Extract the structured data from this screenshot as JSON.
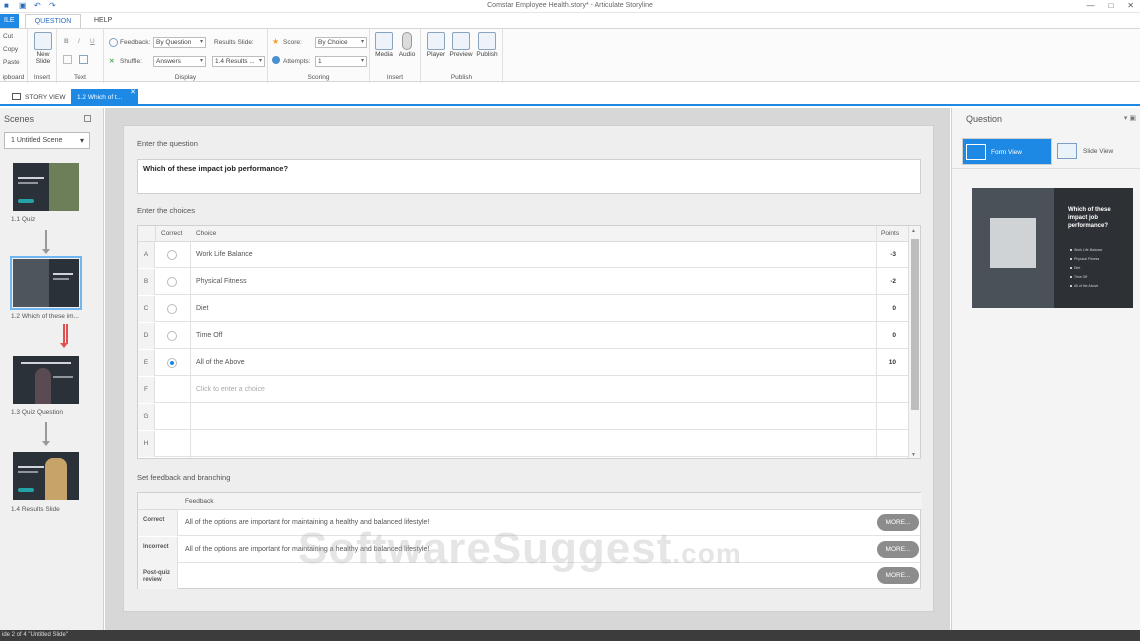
{
  "window": {
    "title": "Comstar Employee Health.story* - Articulate Storyline"
  },
  "ribbon_tabs": {
    "file": "ILE",
    "question": "QUESTION",
    "help": "HELP"
  },
  "ribbon": {
    "clipboard": {
      "cut": "Cut",
      "copy": "Copy",
      "paste": "Paste",
      "label": "ipboard"
    },
    "insert_group": {
      "new_slide": "New Slide",
      "label": "Insert"
    },
    "text_group": {
      "bold": "B",
      "italic": "I",
      "underline": "U",
      "label": "Text"
    },
    "display": {
      "feedback_label": "Feedback:",
      "feedback_value": "By Question",
      "results_label": "Results Slide:",
      "shuffle_label": "Shuffle:",
      "shuffle_value": "Answers",
      "results_value": "1.4 Results ...",
      "label": "Display"
    },
    "scoring": {
      "score_label": "Score:",
      "score_value": "By Choice",
      "attempts_label": "Attempts:",
      "attempts_value": "1",
      "label": "Scoring"
    },
    "insert_media": {
      "media": "Media",
      "audio": "Audio",
      "label": "Insert"
    },
    "publish": {
      "player": "Player",
      "preview": "Preview",
      "publish": "Publish",
      "label": "Publish"
    }
  },
  "doc_tabs": {
    "story_view": "STORY VIEW",
    "slide_tab": "1.2 Which of t..."
  },
  "scenes": {
    "header": "Scenes",
    "selected_scene": "1 Untitled Scene",
    "slides": [
      {
        "caption": "1.1 Quiz"
      },
      {
        "caption": "1.2 Which of these im..."
      },
      {
        "caption": "1.3 Quiz Question"
      },
      {
        "caption": "1.4 Results Slide"
      }
    ]
  },
  "form": {
    "question_label": "Enter the question",
    "question_text": "Which of these impact job performance?",
    "choices_label": "Enter the choices",
    "headers": {
      "correct": "Correct",
      "choice": "Choice",
      "points": "Points"
    },
    "choices": [
      {
        "letter": "A",
        "text": "Work Life Balance",
        "points": "-3",
        "correct": false
      },
      {
        "letter": "B",
        "text": "Physical Fitness",
        "points": "-2",
        "correct": false
      },
      {
        "letter": "C",
        "text": "Diet",
        "points": "0",
        "correct": false
      },
      {
        "letter": "D",
        "text": "Time Off",
        "points": "0",
        "correct": false
      },
      {
        "letter": "E",
        "text": "All of the Above",
        "points": "10",
        "correct": true
      },
      {
        "letter": "F",
        "text": "",
        "placeholder": "Click to enter a choice",
        "points": ""
      },
      {
        "letter": "G",
        "text": "",
        "points": ""
      },
      {
        "letter": "H",
        "text": "",
        "points": ""
      }
    ],
    "feedback_label": "Set feedback and branching",
    "feedback_header": "Feedback",
    "feedback": [
      {
        "label": "Correct",
        "text": "All of the options are important for maintaining a healthy and balanced lifestyle!",
        "button": "MORE..."
      },
      {
        "label": "Incorrect",
        "text": "All of the options are important for maintaining a healthy and balanced lifestyle!",
        "button": "MORE..."
      },
      {
        "label": "Post-quiz review",
        "text": "",
        "button": "MORE..."
      }
    ]
  },
  "question_panel": {
    "header": "Question",
    "form_view": "Form View",
    "slide_view": "Slide View",
    "preview_title": "Which of these impact job performance?",
    "preview_items": [
      "Work Life Balance",
      "Physical Fitness",
      "Diet",
      "Time Off",
      "All of the Above"
    ]
  },
  "status_bar": {
    "text": "ide 2 of 4    \"Untitled Slide\""
  },
  "watermark": {
    "main": "SoftwareSuggest",
    "suffix": ".com"
  },
  "colors": {
    "accent": "#1e88e5",
    "workspace_bg": "#d7d7d7",
    "more_button": "#8c8c8c"
  }
}
